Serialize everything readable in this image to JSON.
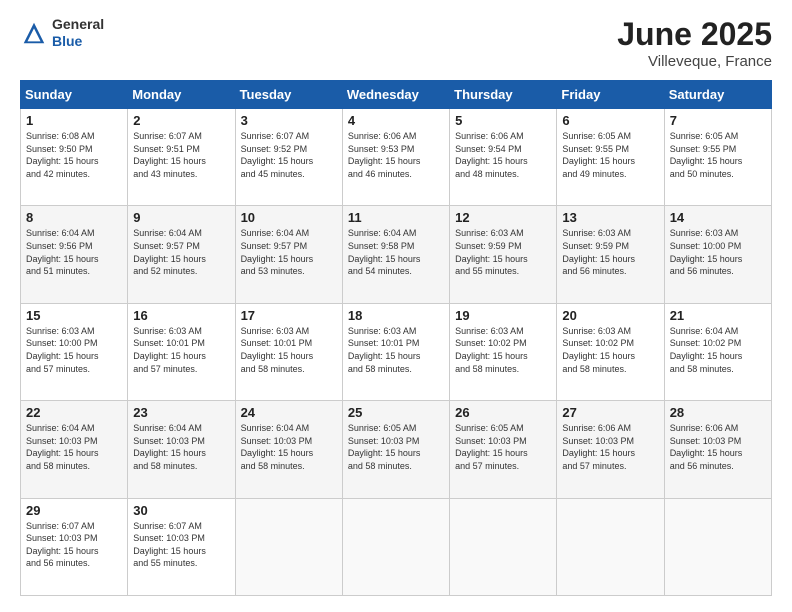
{
  "header": {
    "logo_general": "General",
    "logo_blue": "Blue",
    "title": "June 2025",
    "subtitle": "Villeveque, France"
  },
  "weekdays": [
    "Sunday",
    "Monday",
    "Tuesday",
    "Wednesday",
    "Thursday",
    "Friday",
    "Saturday"
  ],
  "weeks": [
    [
      {
        "day": "1",
        "info": "Sunrise: 6:08 AM\nSunset: 9:50 PM\nDaylight: 15 hours\nand 42 minutes."
      },
      {
        "day": "2",
        "info": "Sunrise: 6:07 AM\nSunset: 9:51 PM\nDaylight: 15 hours\nand 43 minutes."
      },
      {
        "day": "3",
        "info": "Sunrise: 6:07 AM\nSunset: 9:52 PM\nDaylight: 15 hours\nand 45 minutes."
      },
      {
        "day": "4",
        "info": "Sunrise: 6:06 AM\nSunset: 9:53 PM\nDaylight: 15 hours\nand 46 minutes."
      },
      {
        "day": "5",
        "info": "Sunrise: 6:06 AM\nSunset: 9:54 PM\nDaylight: 15 hours\nand 48 minutes."
      },
      {
        "day": "6",
        "info": "Sunrise: 6:05 AM\nSunset: 9:55 PM\nDaylight: 15 hours\nand 49 minutes."
      },
      {
        "day": "7",
        "info": "Sunrise: 6:05 AM\nSunset: 9:55 PM\nDaylight: 15 hours\nand 50 minutes."
      }
    ],
    [
      {
        "day": "8",
        "info": "Sunrise: 6:04 AM\nSunset: 9:56 PM\nDaylight: 15 hours\nand 51 minutes."
      },
      {
        "day": "9",
        "info": "Sunrise: 6:04 AM\nSunset: 9:57 PM\nDaylight: 15 hours\nand 52 minutes."
      },
      {
        "day": "10",
        "info": "Sunrise: 6:04 AM\nSunset: 9:57 PM\nDaylight: 15 hours\nand 53 minutes."
      },
      {
        "day": "11",
        "info": "Sunrise: 6:04 AM\nSunset: 9:58 PM\nDaylight: 15 hours\nand 54 minutes."
      },
      {
        "day": "12",
        "info": "Sunrise: 6:03 AM\nSunset: 9:59 PM\nDaylight: 15 hours\nand 55 minutes."
      },
      {
        "day": "13",
        "info": "Sunrise: 6:03 AM\nSunset: 9:59 PM\nDaylight: 15 hours\nand 56 minutes."
      },
      {
        "day": "14",
        "info": "Sunrise: 6:03 AM\nSunset: 10:00 PM\nDaylight: 15 hours\nand 56 minutes."
      }
    ],
    [
      {
        "day": "15",
        "info": "Sunrise: 6:03 AM\nSunset: 10:00 PM\nDaylight: 15 hours\nand 57 minutes."
      },
      {
        "day": "16",
        "info": "Sunrise: 6:03 AM\nSunset: 10:01 PM\nDaylight: 15 hours\nand 57 minutes."
      },
      {
        "day": "17",
        "info": "Sunrise: 6:03 AM\nSunset: 10:01 PM\nDaylight: 15 hours\nand 58 minutes."
      },
      {
        "day": "18",
        "info": "Sunrise: 6:03 AM\nSunset: 10:01 PM\nDaylight: 15 hours\nand 58 minutes."
      },
      {
        "day": "19",
        "info": "Sunrise: 6:03 AM\nSunset: 10:02 PM\nDaylight: 15 hours\nand 58 minutes."
      },
      {
        "day": "20",
        "info": "Sunrise: 6:03 AM\nSunset: 10:02 PM\nDaylight: 15 hours\nand 58 minutes."
      },
      {
        "day": "21",
        "info": "Sunrise: 6:04 AM\nSunset: 10:02 PM\nDaylight: 15 hours\nand 58 minutes."
      }
    ],
    [
      {
        "day": "22",
        "info": "Sunrise: 6:04 AM\nSunset: 10:03 PM\nDaylight: 15 hours\nand 58 minutes."
      },
      {
        "day": "23",
        "info": "Sunrise: 6:04 AM\nSunset: 10:03 PM\nDaylight: 15 hours\nand 58 minutes."
      },
      {
        "day": "24",
        "info": "Sunrise: 6:04 AM\nSunset: 10:03 PM\nDaylight: 15 hours\nand 58 minutes."
      },
      {
        "day": "25",
        "info": "Sunrise: 6:05 AM\nSunset: 10:03 PM\nDaylight: 15 hours\nand 58 minutes."
      },
      {
        "day": "26",
        "info": "Sunrise: 6:05 AM\nSunset: 10:03 PM\nDaylight: 15 hours\nand 57 minutes."
      },
      {
        "day": "27",
        "info": "Sunrise: 6:06 AM\nSunset: 10:03 PM\nDaylight: 15 hours\nand 57 minutes."
      },
      {
        "day": "28",
        "info": "Sunrise: 6:06 AM\nSunset: 10:03 PM\nDaylight: 15 hours\nand 56 minutes."
      }
    ],
    [
      {
        "day": "29",
        "info": "Sunrise: 6:07 AM\nSunset: 10:03 PM\nDaylight: 15 hours\nand 56 minutes."
      },
      {
        "day": "30",
        "info": "Sunrise: 6:07 AM\nSunset: 10:03 PM\nDaylight: 15 hours\nand 55 minutes."
      },
      {
        "day": "",
        "info": ""
      },
      {
        "day": "",
        "info": ""
      },
      {
        "day": "",
        "info": ""
      },
      {
        "day": "",
        "info": ""
      },
      {
        "day": "",
        "info": ""
      }
    ]
  ]
}
